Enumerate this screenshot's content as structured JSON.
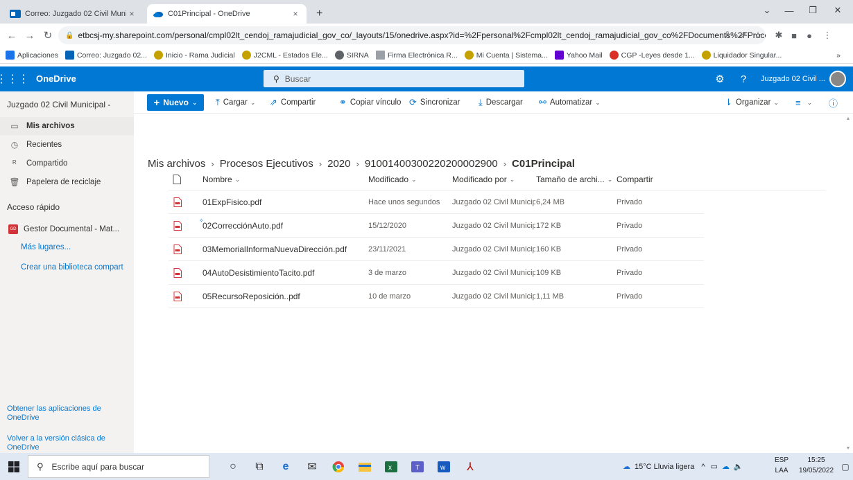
{
  "browser": {
    "tabs": [
      {
        "title": "Correo: Juzgado 02 Civil Municip",
        "close": "×"
      },
      {
        "title": "C01Principal - OneDrive",
        "close": "×"
      }
    ],
    "new_tab": "+",
    "url": "etbcsj-my.sharepoint.com/personal/cmpl02lt_cendoj_ramajudicial_gov_co/_layouts/15/onedrive.aspx?id=%2Fpersonal%2Fcmpl02lt_cendoj_ramajudicial_gov_co%2FDocuments%2FProce...",
    "bookmarks": [
      {
        "label": "Aplicaciones",
        "color": "#1a73e8"
      },
      {
        "label": "Correo: Juzgado 02...",
        "color": "#0364b8"
      },
      {
        "label": "Inicio - Rama Judicial",
        "color": "#c5a100"
      },
      {
        "label": "J2CML - Estados Ele...",
        "color": "#c5a100"
      },
      {
        "label": "SIRNA",
        "color": "#5f6368"
      },
      {
        "label": "Firma Electrónica R...",
        "color": "#9aa0a6"
      },
      {
        "label": "Mi Cuenta | Sistema...",
        "color": "#c5a100"
      },
      {
        "label": "Yahoo Mail",
        "color": "#6001d2"
      },
      {
        "label": "CGP -Leyes desde 1...",
        "color": "#d93025"
      },
      {
        "label": "Liquidador Singular...",
        "color": "#c5a100"
      }
    ],
    "bookmarks_more": "»"
  },
  "suite": {
    "app_name": "OneDrive",
    "search_placeholder": "Buscar",
    "account_name": "Juzgado 02 Civil ...",
    "brand_color": "#0078d4"
  },
  "leftnav": {
    "owner": "Juzgado 02 Civil Municipal -",
    "items": [
      {
        "label": "Mis archivos",
        "icon": "folder-icon"
      },
      {
        "label": "Recientes",
        "icon": "clock-icon"
      },
      {
        "label": "Compartido",
        "icon": "people-icon"
      },
      {
        "label": "Papelera de reciclaje",
        "icon": "trash-icon"
      }
    ],
    "quick_access_title": "Acceso rápido",
    "quick_item": {
      "label": "Gestor Documental - Mat...",
      "badge": "GD"
    },
    "more_places": "Más lugares...",
    "create_library": "Crear una biblioteca compart",
    "get_apps": "Obtener las aplicaciones de OneDrive",
    "classic": "Volver a la versión clásica de OneDrive"
  },
  "commands": {
    "new": "Nuevo",
    "upload": "Cargar",
    "share": "Compartir",
    "copy_link": "Copiar vínculo",
    "sync": "Sincronizar",
    "download": "Descargar",
    "automate": "Automatizar",
    "organize": "Organizar"
  },
  "breadcrumb": [
    "Mis archivos",
    "Procesos Ejecutivos",
    "2020",
    "91001400300220200002900",
    "C01Principal"
  ],
  "table": {
    "headers": {
      "name": "Nombre",
      "modified": "Modificado",
      "modified_by": "Modificado por",
      "size": "Tamaño de archi...",
      "sharing": "Compartir"
    },
    "rows": [
      {
        "name": "01ExpFisico.pdf",
        "modified": "Hace unos segundos",
        "modified_by": "Juzgado 02 Civil Municipa",
        "size": "6,24 MB",
        "sharing": "Privado",
        "new": false
      },
      {
        "name": "02CorrecciónAuto.pdf",
        "modified": "15/12/2020",
        "modified_by": "Juzgado 02 Civil Municipa",
        "size": "172 KB",
        "sharing": "Privado",
        "new": true
      },
      {
        "name": "03MemorialInformaNuevaDirección.pdf",
        "modified": "23/11/2021",
        "modified_by": "Juzgado 02 Civil Municipa",
        "size": "160 KB",
        "sharing": "Privado",
        "new": false
      },
      {
        "name": "04AutoDesistimientoTacito.pdf",
        "modified": "3 de marzo",
        "modified_by": "Juzgado 02 Civil Municipa",
        "size": "109 KB",
        "sharing": "Privado",
        "new": false
      },
      {
        "name": "05RecursoReposición..pdf",
        "modified": "10 de marzo",
        "modified_by": "Juzgado 02 Civil Municipa",
        "size": "1,11 MB",
        "sharing": "Privado",
        "new": false
      }
    ]
  },
  "taskbar": {
    "search_placeholder": "Escribe aquí para buscar",
    "weather": "15°C  Lluvia ligera",
    "lang_top": "ESP",
    "lang_bottom": "LAA",
    "time": "15:25",
    "date": "19/05/2022"
  }
}
